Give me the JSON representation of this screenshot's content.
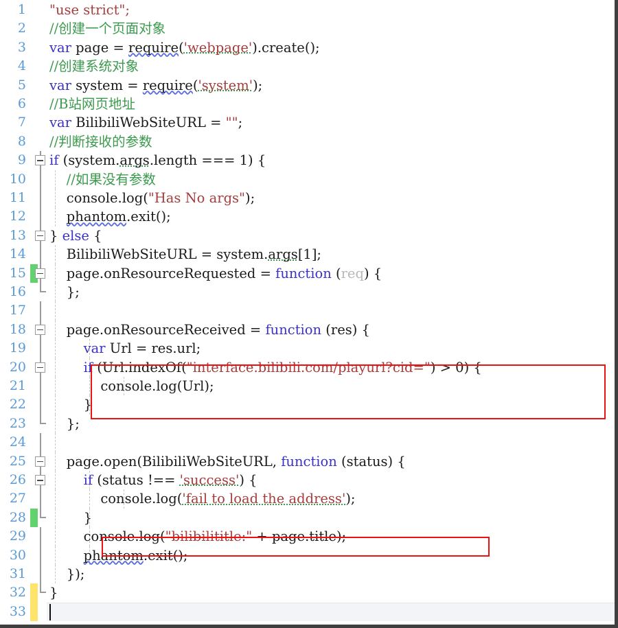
{
  "editor": {
    "language": "JavaScript",
    "total_lines": 33,
    "caret_line": 33,
    "colors": {
      "line_number": "#5b9bd5",
      "keyword": "#3a32c8",
      "string": "#a63c3c",
      "comment": "#3c9a4e",
      "plain_text": "#1a1a1a",
      "unused_param": "#b8b8b8",
      "change_added": "#62d26f",
      "change_modified": "#ffe46b",
      "annotation_box": "#ee1111",
      "background": "#ffffff",
      "current_line": "#f2f4f8"
    }
  },
  "annotations": [
    {
      "name": "highlight-box-playurl-check",
      "lines": [
        20,
        21,
        22
      ],
      "label": "if (Url.indexOf(\"interface.bilibili.com/playurl?cid=\") > 0) {"
    },
    {
      "name": "highlight-box-title-log",
      "lines": [
        29
      ],
      "label": "console.log(\"bilibilititle:\" + page.title);"
    }
  ],
  "lines": [
    {
      "num": 1,
      "indent": 0,
      "fold": "none",
      "change": "none",
      "guides": [],
      "tokens": [
        {
          "t": "\"use strict\";",
          "c": "str"
        }
      ]
    },
    {
      "num": 2,
      "indent": 0,
      "fold": "none",
      "change": "none",
      "guides": [],
      "tokens": [
        {
          "t": "//创建一个页面对象",
          "c": "cmt"
        }
      ]
    },
    {
      "num": 3,
      "indent": 0,
      "fold": "none",
      "change": "none",
      "guides": [],
      "tokens": [
        {
          "t": "var",
          "c": "kw"
        },
        {
          "t": " page = ",
          "c": "plain"
        },
        {
          "t": "require",
          "c": "squig"
        },
        {
          "t": "(",
          "c": "plain"
        },
        {
          "t": "'webpage'",
          "c": "str dotted"
        },
        {
          "t": ").create();",
          "c": "plain"
        }
      ]
    },
    {
      "num": 4,
      "indent": 0,
      "fold": "none",
      "change": "none",
      "guides": [],
      "tokens": [
        {
          "t": "//创建系统对象",
          "c": "cmt"
        }
      ]
    },
    {
      "num": 5,
      "indent": 0,
      "fold": "none",
      "change": "none",
      "guides": [],
      "tokens": [
        {
          "t": "var",
          "c": "kw"
        },
        {
          "t": " system = ",
          "c": "plain"
        },
        {
          "t": "require",
          "c": "squig"
        },
        {
          "t": "(",
          "c": "plain"
        },
        {
          "t": "'system'",
          "c": "str dotted"
        },
        {
          "t": ");",
          "c": "plain"
        }
      ]
    },
    {
      "num": 6,
      "indent": 0,
      "fold": "none",
      "change": "none",
      "guides": [],
      "tokens": [
        {
          "t": "//B站网页地址",
          "c": "cmt"
        }
      ]
    },
    {
      "num": 7,
      "indent": 0,
      "fold": "none",
      "change": "none",
      "guides": [],
      "tokens": [
        {
          "t": "var",
          "c": "kw"
        },
        {
          "t": " BilibiliWebSiteURL = ",
          "c": "plain"
        },
        {
          "t": "\"\"",
          "c": "str"
        },
        {
          "t": ";",
          "c": "plain"
        }
      ]
    },
    {
      "num": 8,
      "indent": 0,
      "fold": "none",
      "change": "none",
      "guides": [],
      "tokens": [
        {
          "t": "//判断接收的参数",
          "c": "cmt"
        }
      ]
    },
    {
      "num": 9,
      "indent": 0,
      "fold": "box",
      "change": "none",
      "guides": [],
      "tokens": [
        {
          "t": "if",
          "c": "kw"
        },
        {
          "t": " (system.",
          "c": "plain"
        },
        {
          "t": "args",
          "c": "dotted"
        },
        {
          "t": ".length === 1) {",
          "c": "plain"
        }
      ]
    },
    {
      "num": 10,
      "indent": 0,
      "fold": "line",
      "change": "none",
      "guides": [
        80
      ],
      "tokens": [
        {
          "t": "    //如果没有参数",
          "c": "cmt"
        }
      ]
    },
    {
      "num": 11,
      "indent": 0,
      "fold": "line",
      "change": "none",
      "guides": [
        80
      ],
      "tokens": [
        {
          "t": "    console.log(",
          "c": "plain"
        },
        {
          "t": "\"Has No args\"",
          "c": "str"
        },
        {
          "t": ");",
          "c": "plain"
        }
      ]
    },
    {
      "num": 12,
      "indent": 0,
      "fold": "line",
      "change": "none",
      "guides": [
        80
      ],
      "tokens": [
        {
          "t": "    ",
          "c": "plain"
        },
        {
          "t": "phantom",
          "c": "squig"
        },
        {
          "t": ".exit();",
          "c": "plain"
        }
      ]
    },
    {
      "num": 13,
      "indent": 0,
      "fold": "box",
      "change": "none",
      "guides": [],
      "tokens": [
        {
          "t": "} ",
          "c": "plain"
        },
        {
          "t": "else",
          "c": "kw"
        },
        {
          "t": " {",
          "c": "plain"
        }
      ]
    },
    {
      "num": 14,
      "indent": 0,
      "fold": "line-top",
      "change": "none",
      "guides": [
        80
      ],
      "tokens": [
        {
          "t": "    BilibiliWebSiteURL = system.",
          "c": "plain"
        },
        {
          "t": "args",
          "c": "dotted"
        },
        {
          "t": "[1];",
          "c": "plain"
        }
      ]
    },
    {
      "num": 15,
      "indent": 0,
      "fold": "box",
      "change": "green",
      "guides": [
        80
      ],
      "tokens": [
        {
          "t": "    page.onResourceRequested = ",
          "c": "plain"
        },
        {
          "t": "function",
          "c": "kw"
        },
        {
          "t": " (",
          "c": "plain"
        },
        {
          "t": "req",
          "c": "dim"
        },
        {
          "t": ") {",
          "c": "plain"
        }
      ]
    },
    {
      "num": 16,
      "indent": 0,
      "fold": "line-end",
      "change": "none",
      "guides": [
        80
      ],
      "tokens": [
        {
          "t": "    };",
          "c": "plain"
        }
      ]
    },
    {
      "num": 17,
      "indent": 0,
      "fold": "line",
      "change": "none",
      "guides": [
        80
      ],
      "tokens": []
    },
    {
      "num": 18,
      "indent": 0,
      "fold": "box",
      "change": "none",
      "guides": [
        80
      ],
      "tokens": [
        {
          "t": "    page.onResourceReceived = ",
          "c": "plain"
        },
        {
          "t": "function",
          "c": "kw"
        },
        {
          "t": " (res) {",
          "c": "plain"
        }
      ]
    },
    {
      "num": 19,
      "indent": 0,
      "fold": "line",
      "change": "none",
      "guides": [
        80,
        130
      ],
      "tokens": [
        {
          "t": "        ",
          "c": "plain"
        },
        {
          "t": "var",
          "c": "kw"
        },
        {
          "t": " Url = res.url;",
          "c": "plain"
        }
      ]
    },
    {
      "num": 20,
      "indent": 0,
      "fold": "box",
      "change": "none",
      "guides": [
        80,
        130
      ],
      "tokens": [
        {
          "t": "        ",
          "c": "plain"
        },
        {
          "t": "if",
          "c": "kw"
        },
        {
          "t": " (Url.indexOf(",
          "c": "plain"
        },
        {
          "t": "\"interface.bilibili.com/playurl?cid=\"",
          "c": "str"
        },
        {
          "t": ") > 0) {",
          "c": "plain"
        }
      ]
    },
    {
      "num": 21,
      "indent": 0,
      "fold": "line",
      "change": "none",
      "guides": [
        80,
        130,
        180
      ],
      "tokens": [
        {
          "t": "            console.log(Url);",
          "c": "plain"
        }
      ]
    },
    {
      "num": 22,
      "indent": 0,
      "fold": "line",
      "change": "none",
      "guides": [
        80,
        130
      ],
      "tokens": [
        {
          "t": "        }",
          "c": "plain"
        }
      ]
    },
    {
      "num": 23,
      "indent": 0,
      "fold": "line-end",
      "change": "none",
      "guides": [
        80
      ],
      "tokens": [
        {
          "t": "    };",
          "c": "plain"
        }
      ]
    },
    {
      "num": 24,
      "indent": 0,
      "fold": "line",
      "change": "none",
      "guides": [
        80
      ],
      "tokens": []
    },
    {
      "num": 25,
      "indent": 0,
      "fold": "box",
      "change": "none",
      "guides": [
        80
      ],
      "tokens": [
        {
          "t": "    page.open(BilibiliWebSiteURL, ",
          "c": "plain"
        },
        {
          "t": "function",
          "c": "kw"
        },
        {
          "t": " (status) {",
          "c": "plain"
        }
      ]
    },
    {
      "num": 26,
      "indent": 0,
      "fold": "box",
      "change": "none",
      "guides": [
        80,
        130
      ],
      "tokens": [
        {
          "t": "        ",
          "c": "plain"
        },
        {
          "t": "if",
          "c": "kw"
        },
        {
          "t": " (status !== ",
          "c": "plain"
        },
        {
          "t": "'success'",
          "c": "str dotted"
        },
        {
          "t": ") {",
          "c": "plain"
        }
      ]
    },
    {
      "num": 27,
      "indent": 0,
      "fold": "line",
      "change": "none",
      "guides": [
        80,
        130,
        180
      ],
      "tokens": [
        {
          "t": "            console.log(",
          "c": "plain"
        },
        {
          "t": "'fail to load the address'",
          "c": "str dotted"
        },
        {
          "t": ");",
          "c": "plain"
        }
      ]
    },
    {
      "num": 28,
      "indent": 0,
      "fold": "line-end",
      "change": "green",
      "guides": [
        80,
        130
      ],
      "tokens": [
        {
          "t": "        }",
          "c": "plain"
        }
      ]
    },
    {
      "num": 29,
      "indent": 0,
      "fold": "line",
      "change": "none",
      "guides": [
        80,
        130
      ],
      "tokens": [
        {
          "t": "        console.log(",
          "c": "plain"
        },
        {
          "t": "\"bilibilititle:\"",
          "c": "str"
        },
        {
          "t": " + page.title);",
          "c": "plain"
        }
      ]
    },
    {
      "num": 30,
      "indent": 0,
      "fold": "line",
      "change": "none",
      "guides": [
        80,
        130
      ],
      "tokens": [
        {
          "t": "        ",
          "c": "plain"
        },
        {
          "t": "phantom",
          "c": "squig"
        },
        {
          "t": ".exit();",
          "c": "plain"
        }
      ]
    },
    {
      "num": 31,
      "indent": 0,
      "fold": "line",
      "change": "none",
      "guides": [
        80
      ],
      "tokens": [
        {
          "t": "    });",
          "c": "plain"
        }
      ]
    },
    {
      "num": 32,
      "indent": 0,
      "fold": "line-end",
      "change": "yellow",
      "guides": [],
      "tokens": [
        {
          "t": "}",
          "c": "plain"
        }
      ]
    },
    {
      "num": 33,
      "indent": 0,
      "fold": "none",
      "change": "yellow",
      "guides": [],
      "current": true,
      "tokens": []
    }
  ]
}
